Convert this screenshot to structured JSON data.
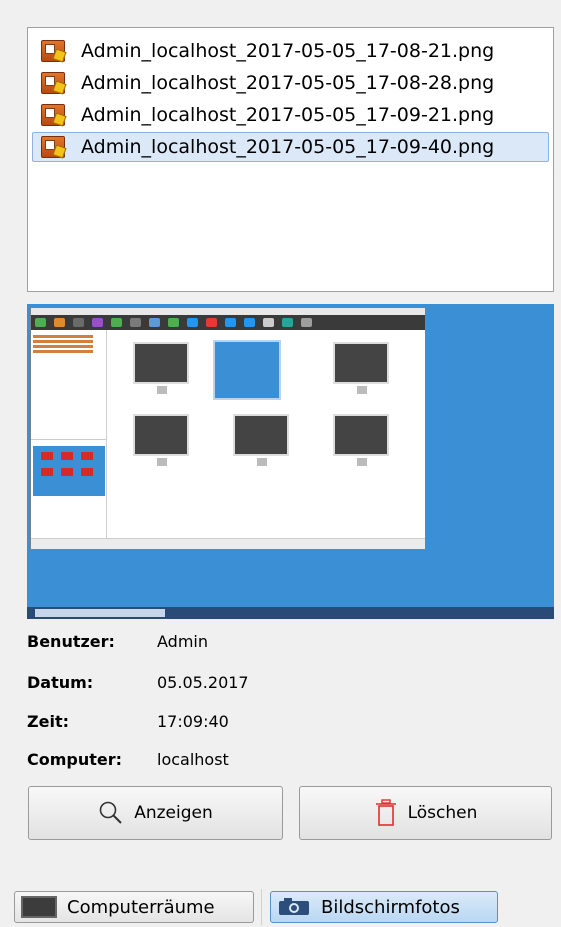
{
  "files": [
    {
      "name": "Admin_localhost_2017-05-05_17-08-21.png",
      "selected": false
    },
    {
      "name": "Admin_localhost_2017-05-05_17-08-28.png",
      "selected": false
    },
    {
      "name": "Admin_localhost_2017-05-05_17-09-21.png",
      "selected": false
    },
    {
      "name": "Admin_localhost_2017-05-05_17-09-40.png",
      "selected": true
    }
  ],
  "info": {
    "user_label": "Benutzer:",
    "user_value": "Admin",
    "date_label": "Datum:",
    "date_value": "05.05.2017",
    "time_label": "Zeit:",
    "time_value": "17:09:40",
    "computer_label": "Computer:",
    "computer_value": "localhost"
  },
  "buttons": {
    "show_label": "Anzeigen",
    "delete_label": "Löschen"
  },
  "tabs": {
    "rooms_label": "Computerräume",
    "screenshots_label": "Bildschirmfotos"
  },
  "colors": {
    "accent": "#3b8fd4",
    "delete_icon": "#e03030",
    "selection": "#dbe8f8"
  },
  "icons": {
    "file": "image-file-icon",
    "show": "magnifier-icon",
    "delete": "trash-icon",
    "rooms": "monitor-icon",
    "screenshots": "camera-icon"
  }
}
